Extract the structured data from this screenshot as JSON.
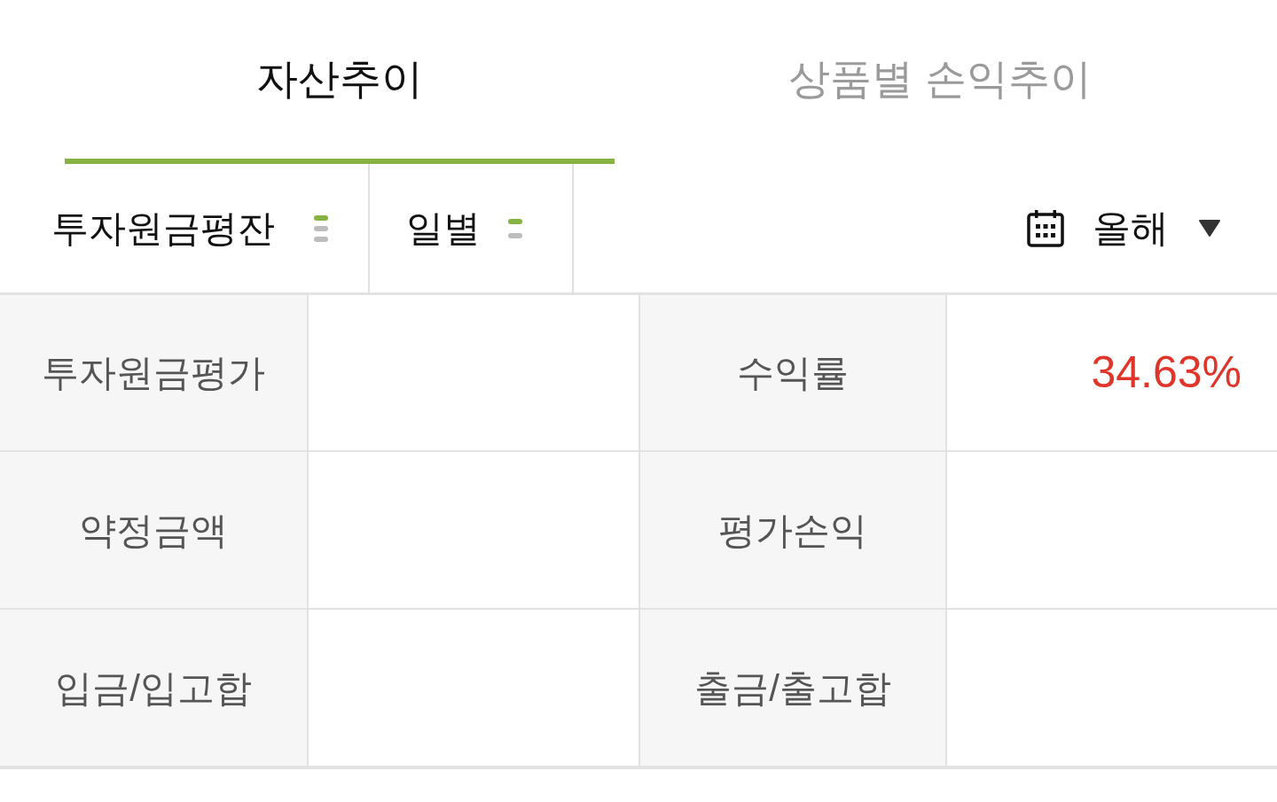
{
  "tabs": [
    {
      "label": "자산추이",
      "selected": true
    },
    {
      "label": "상품별 손익추이",
      "selected": false
    }
  ],
  "filters": [
    {
      "label": "투자원금평잔",
      "kind": "triple"
    },
    {
      "label": "일별",
      "kind": "double"
    }
  ],
  "period": {
    "label": "올해"
  },
  "summary": [
    {
      "label": "투자원금평가"
    },
    {
      "label": "수익률",
      "value": "34.63%",
      "gain": true
    },
    {
      "label": "약정금액"
    },
    {
      "label": "평가손익"
    },
    {
      "label": "입금/입고합"
    },
    {
      "label": "출금/출고합"
    }
  ]
}
